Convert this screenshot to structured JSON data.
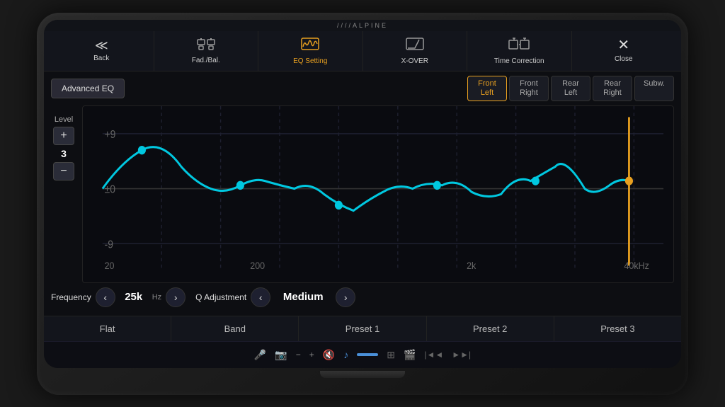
{
  "brand": "////ALPINE",
  "nav": {
    "items": [
      {
        "id": "back",
        "label": "Back",
        "icon": "≪",
        "active": false
      },
      {
        "id": "fad-bal",
        "label": "Fad./Bal.",
        "icon": "⊞",
        "active": false
      },
      {
        "id": "eq-setting",
        "label": "EQ Setting",
        "icon": "〜",
        "active": true
      },
      {
        "id": "x-over",
        "label": "X-OVER",
        "icon": "◸",
        "active": false
      },
      {
        "id": "time-correction",
        "label": "Time Correction",
        "icon": "⊡",
        "active": false
      },
      {
        "id": "close",
        "label": "Close",
        "icon": "✕",
        "active": false
      }
    ]
  },
  "advanced_eq_label": "Advanced EQ",
  "channels": [
    {
      "id": "front-left",
      "label": "Front\nLeft",
      "active": true
    },
    {
      "id": "front-right",
      "label": "Front\nRight",
      "active": false
    },
    {
      "id": "rear-left",
      "label": "Rear\nLeft",
      "active": false
    },
    {
      "id": "rear-right",
      "label": "Rear\nRight",
      "active": false
    },
    {
      "id": "subw",
      "label": "Subw.",
      "active": false
    }
  ],
  "level": {
    "label": "Level",
    "value": "3",
    "plus": "+",
    "minus": "−",
    "grid_top": "+9",
    "grid_mid": "±0",
    "grid_bot": "-9"
  },
  "freq_labels": [
    "20",
    "200",
    "2k",
    "40kHz"
  ],
  "controls": {
    "frequency_label": "Frequency",
    "frequency_value": "25k",
    "frequency_unit": "Hz",
    "q_adj_label": "Q Adjustment",
    "q_adj_value": "Medium",
    "prev": "‹",
    "next": "›"
  },
  "presets": [
    {
      "id": "flat",
      "label": "Flat"
    },
    {
      "id": "band",
      "label": "Band"
    },
    {
      "id": "preset1",
      "label": "Preset 1"
    },
    {
      "id": "preset2",
      "label": "Preset 2"
    },
    {
      "id": "preset3",
      "label": "Preset 3"
    }
  ],
  "bottom_icons": [
    "🎤",
    "📷",
    "−",
    "+",
    "🔇",
    "🎵",
    "⊞",
    "🎬",
    "|◄◄",
    "►►|",
    "⊞"
  ]
}
